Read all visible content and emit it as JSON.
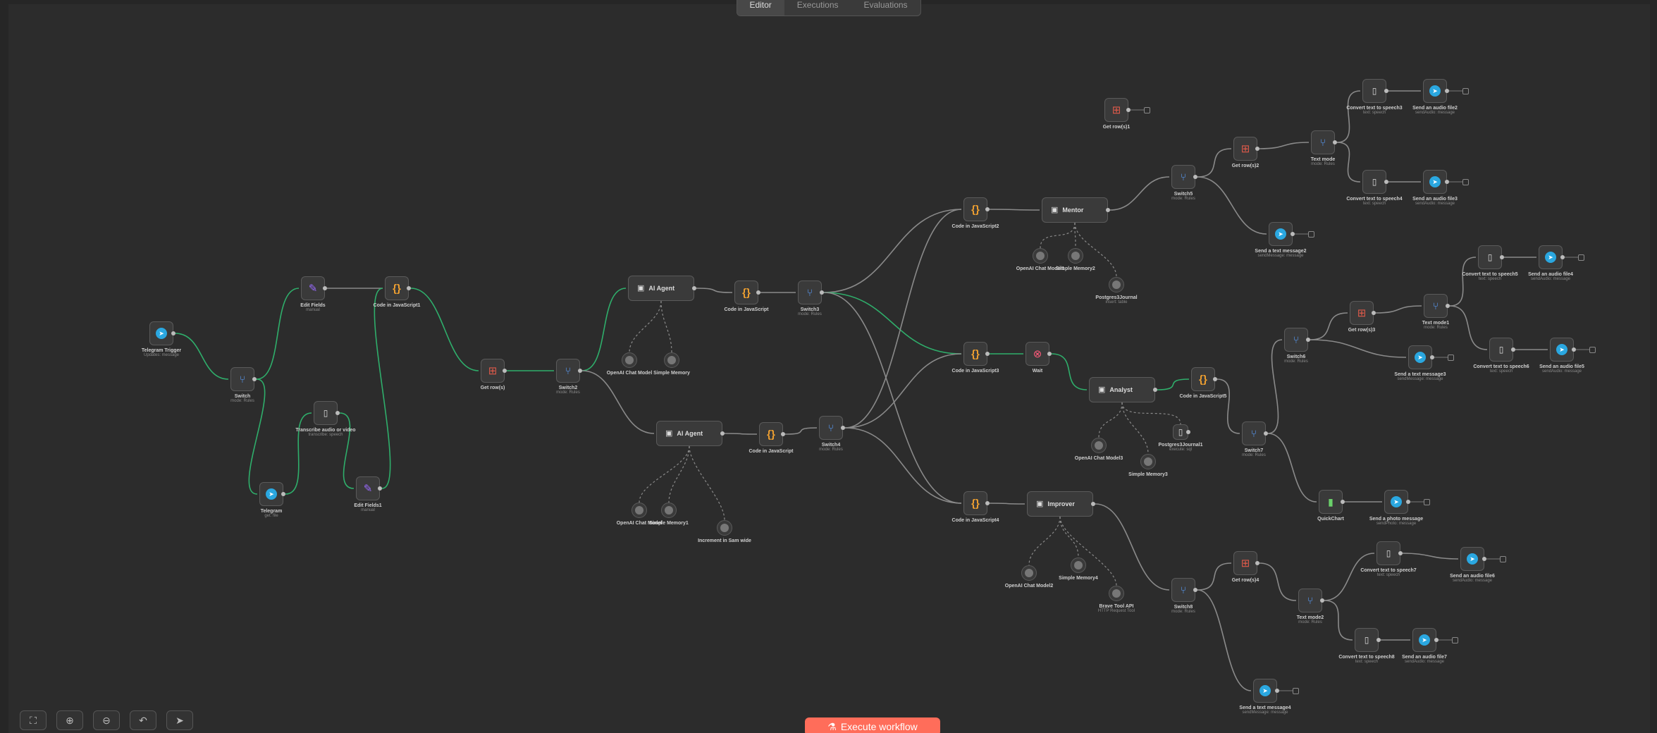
{
  "top_tabs": [
    "Editor",
    "Executions",
    "Evaluations"
  ],
  "toolbar": {
    "buttons": [
      {
        "name": "fit-view-button",
        "icon": "⛶"
      },
      {
        "name": "zoom-in-button",
        "icon": "⊕"
      },
      {
        "name": "zoom-out-button",
        "icon": "⊖"
      },
      {
        "name": "undo-button",
        "icon": "↶"
      },
      {
        "name": "pointer-button",
        "icon": "➤"
      }
    ]
  },
  "execute": {
    "label": "Execute workflow",
    "icon": "⚗"
  },
  "colors": {
    "accent": "#ff6d5a",
    "canvas": "#2c2c2c",
    "edge": "#8a8a8a",
    "edge_active": "#2fae6b"
  },
  "nodes": [
    {
      "id": "telegram-trigger",
      "kind": "telegram",
      "label": "Telegram Trigger",
      "sub": "Updates: message"
    },
    {
      "id": "switch-1",
      "kind": "switch",
      "label": "Switch",
      "sub": "mode: Rules"
    },
    {
      "id": "edit-fields",
      "kind": "edit",
      "label": "Edit Fields",
      "sub": "manual"
    },
    {
      "id": "code-js-1",
      "kind": "code",
      "label": "Code in JavaScript1",
      "sub": ""
    },
    {
      "id": "telegram-getfile",
      "kind": "telegram",
      "label": "Telegram",
      "sub": "get: file"
    },
    {
      "id": "transcribe",
      "kind": "file",
      "label": "Transcribe audio or video",
      "sub": "transcribe: speech"
    },
    {
      "id": "edit-fields-1",
      "kind": "edit",
      "label": "Edit Fields1",
      "sub": "manual"
    },
    {
      "id": "get-rows",
      "kind": "sheet",
      "label": "Get row(s)",
      "sub": ""
    },
    {
      "id": "switch-2",
      "kind": "switch",
      "label": "Switch2",
      "sub": "mode: Rules"
    },
    {
      "id": "ai-agent-1",
      "kind": "agent",
      "label": "AI Agent",
      "sub": ""
    },
    {
      "id": "code-js-top",
      "kind": "code",
      "label": "Code in JavaScript",
      "sub": ""
    },
    {
      "id": "switch-3",
      "kind": "switch",
      "label": "Switch3",
      "sub": "mode: Rules"
    },
    {
      "id": "openai-1",
      "kind": "circle",
      "label": "OpenAI Chat Model",
      "sub": ""
    },
    {
      "id": "memory-1",
      "kind": "circle",
      "label": "Simple Memory",
      "sub": ""
    },
    {
      "id": "ai-agent-2",
      "kind": "agent",
      "label": "AI Agent",
      "sub": ""
    },
    {
      "id": "code-js-mid",
      "kind": "code",
      "label": "Code in JavaScript",
      "sub": ""
    },
    {
      "id": "switch-4",
      "kind": "switch",
      "label": "Switch4",
      "sub": "mode: Rules"
    },
    {
      "id": "openai-2",
      "kind": "circle",
      "label": "OpenAI Chat Model",
      "sub": ""
    },
    {
      "id": "memory-2",
      "kind": "circle",
      "label": "Simple Memory1",
      "sub": ""
    },
    {
      "id": "increment-tool",
      "kind": "circle",
      "label": "Increment in Sam wide",
      "sub": ""
    },
    {
      "id": "code-js-a",
      "kind": "code",
      "label": "Code in JavaScript2",
      "sub": ""
    },
    {
      "id": "agent-mentor",
      "kind": "agent",
      "label": "Mentor",
      "sub": ""
    },
    {
      "id": "openai-3",
      "kind": "circle",
      "label": "OpenAI Chat Model1",
      "sub": ""
    },
    {
      "id": "memory-3",
      "kind": "circle",
      "label": "Simple Memory2",
      "sub": ""
    },
    {
      "id": "postgres-1",
      "kind": "circle",
      "label": "Postgres3Journal",
      "sub": "insert: table"
    },
    {
      "id": "get-rows-1",
      "kind": "sheet",
      "label": "Get row(s)1",
      "sub": ""
    },
    {
      "id": "switch-5",
      "kind": "switch",
      "label": "Switch5",
      "sub": "mode: Rules"
    },
    {
      "id": "get-rows-2",
      "kind": "sheet",
      "label": "Get row(s)2",
      "sub": ""
    },
    {
      "id": "text-mode-1",
      "kind": "switch",
      "label": "Text mode",
      "sub": "mode: Rules"
    },
    {
      "id": "tts-1",
      "kind": "file",
      "label": "Convert text to speech3",
      "sub": "text: speech"
    },
    {
      "id": "send-audio-1",
      "kind": "telegram",
      "label": "Send an audio file2",
      "sub": "sendAudio: message"
    },
    {
      "id": "tts-2",
      "kind": "file",
      "label": "Convert text to speech4",
      "sub": "text: speech"
    },
    {
      "id": "send-audio-2",
      "kind": "telegram",
      "label": "Send an audio file3",
      "sub": "sendAudio: message"
    },
    {
      "id": "send-text-1",
      "kind": "telegram",
      "label": "Send a text message2",
      "sub": "sendMessage: message"
    },
    {
      "id": "code-js-b",
      "kind": "code",
      "label": "Code in JavaScript3",
      "sub": ""
    },
    {
      "id": "wait",
      "kind": "stop",
      "label": "Wait",
      "sub": ""
    },
    {
      "id": "agent-analyst",
      "kind": "agent",
      "label": "Analyst",
      "sub": ""
    },
    {
      "id": "code-js-c",
      "kind": "code",
      "label": "Code in JavaScript5",
      "sub": ""
    },
    {
      "id": "openai-4",
      "kind": "circle",
      "label": "OpenAI Chat Model3",
      "sub": ""
    },
    {
      "id": "memory-4",
      "kind": "circle",
      "label": "Simple Memory3",
      "sub": ""
    },
    {
      "id": "postgres-2",
      "kind": "file",
      "label": "Postgres3Journal1",
      "sub": "execute: sql"
    },
    {
      "id": "switch-7",
      "kind": "switch",
      "label": "Switch7",
      "sub": "mode: Rules"
    },
    {
      "id": "switch-6",
      "kind": "switch",
      "label": "Switch6",
      "sub": "mode: Rules"
    },
    {
      "id": "get-rows-3",
      "kind": "sheet",
      "label": "Get row(s)3",
      "sub": ""
    },
    {
      "id": "text-mode-2",
      "kind": "switch",
      "label": "Text mode1",
      "sub": "mode: Rules"
    },
    {
      "id": "tts-3",
      "kind": "file",
      "label": "Convert text to speech5",
      "sub": "text: speech"
    },
    {
      "id": "send-audio-3",
      "kind": "telegram",
      "label": "Send an audio file4",
      "sub": "sendAudio: message"
    },
    {
      "id": "tts-4",
      "kind": "file",
      "label": "Convert text to speech6",
      "sub": "text: speech"
    },
    {
      "id": "send-audio-4",
      "kind": "telegram",
      "label": "Send an audio file5",
      "sub": "sendAudio: message"
    },
    {
      "id": "send-text-2",
      "kind": "telegram",
      "label": "Send a text message3",
      "sub": "sendMessage: message"
    },
    {
      "id": "quickchart",
      "kind": "bars",
      "label": "QuickChart",
      "sub": ""
    },
    {
      "id": "send-photo",
      "kind": "telegram",
      "label": "Send a photo message",
      "sub": "sendPhoto: message"
    },
    {
      "id": "code-js-d",
      "kind": "code",
      "label": "Code in JavaScript4",
      "sub": ""
    },
    {
      "id": "agent-improver",
      "kind": "agent",
      "label": "Improver",
      "sub": ""
    },
    {
      "id": "openai-5",
      "kind": "circle",
      "label": "OpenAI Chat Model2",
      "sub": ""
    },
    {
      "id": "memory-5",
      "kind": "circle",
      "label": "Simple Memory4",
      "sub": ""
    },
    {
      "id": "brave-tool",
      "kind": "circle",
      "label": "Brave Tool API",
      "sub": "HTTP Request Tool"
    },
    {
      "id": "switch-8",
      "kind": "switch",
      "label": "Switch8",
      "sub": "mode: Rules"
    },
    {
      "id": "get-rows-4",
      "kind": "sheet",
      "label": "Get row(s)4",
      "sub": ""
    },
    {
      "id": "text-mode-3",
      "kind": "switch",
      "label": "Text mode2",
      "sub": "mode: Rules"
    },
    {
      "id": "tts-5",
      "kind": "file",
      "label": "Convert text to speech7",
      "sub": "text: speech"
    },
    {
      "id": "send-audio-5",
      "kind": "telegram",
      "label": "Send an audio file6",
      "sub": "sendAudio: message"
    },
    {
      "id": "tts-6",
      "kind": "file",
      "label": "Convert text to speech8",
      "sub": "text: speech"
    },
    {
      "id": "send-audio-6",
      "kind": "telegram",
      "label": "Send an audio file7",
      "sub": "sendAudio: message"
    },
    {
      "id": "send-text-3",
      "kind": "telegram",
      "label": "Send a text message4",
      "sub": "sendMessage: message"
    }
  ]
}
